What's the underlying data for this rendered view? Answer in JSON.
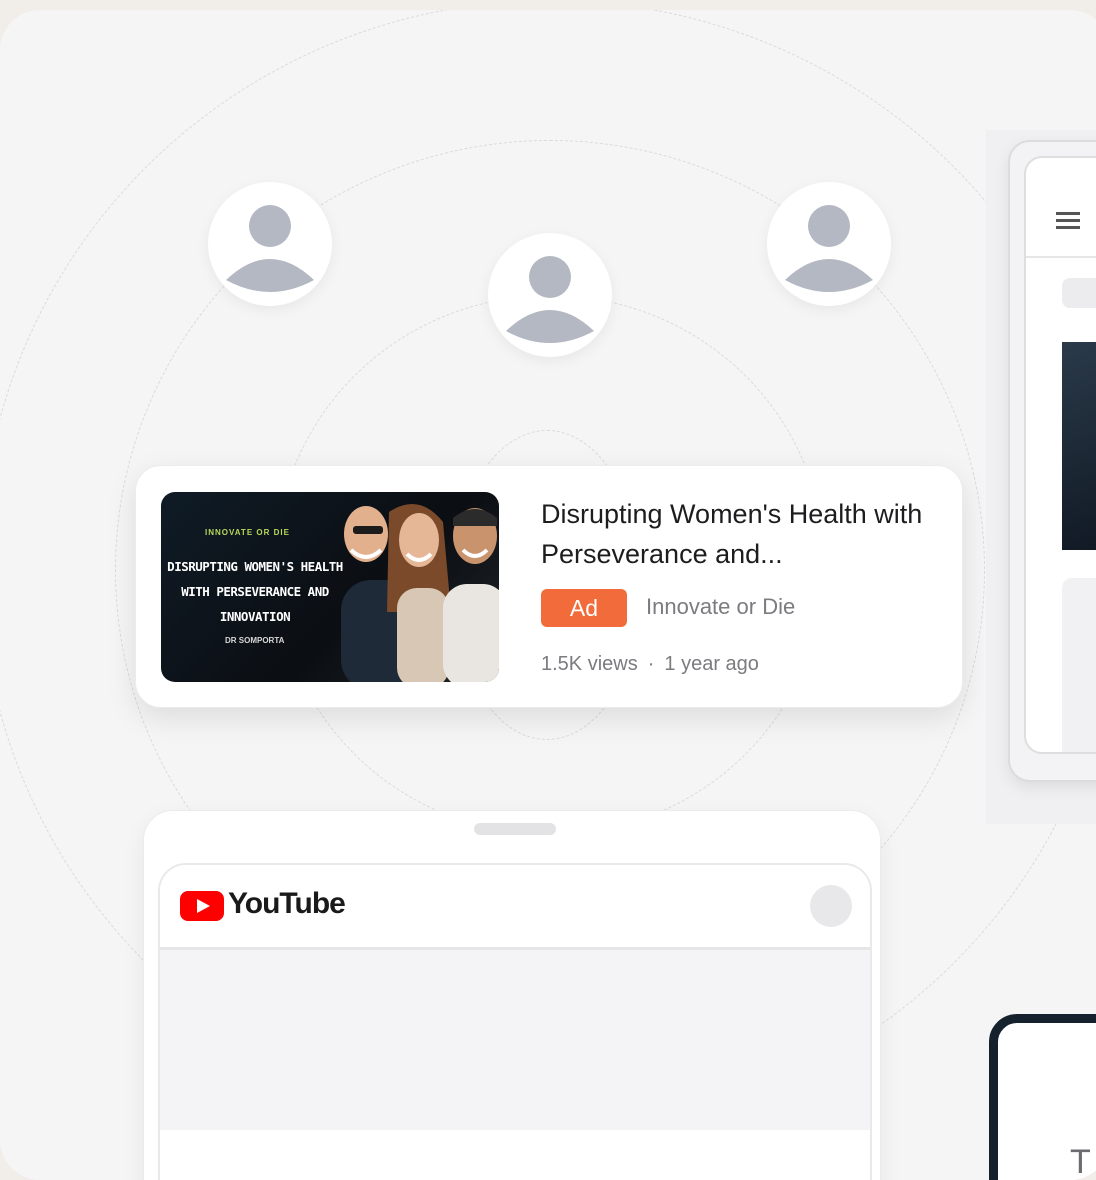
{
  "ad": {
    "title": "Disrupting Women's Health with Perseverance and...",
    "badge": "Ad",
    "channel": "Innovate or Die",
    "views": "1.5K views",
    "separator": "·",
    "age": "1 year ago",
    "thumbnail": {
      "brand": "INNOVATE OR DIE",
      "headline": "DISRUPTING WOMEN'S HEALTH WITH PERSEVERANCE AND INNOVATION",
      "byline": "DR SOMPORTA"
    }
  },
  "youtube": {
    "wordmark": "YouTube"
  },
  "side_peek": {
    "text": "T"
  },
  "colors": {
    "ad_badge": "#f26b3a",
    "youtube_red": "#ff0000",
    "avatar_gray": "#b4b8c3",
    "background": "#f5f5f6"
  }
}
